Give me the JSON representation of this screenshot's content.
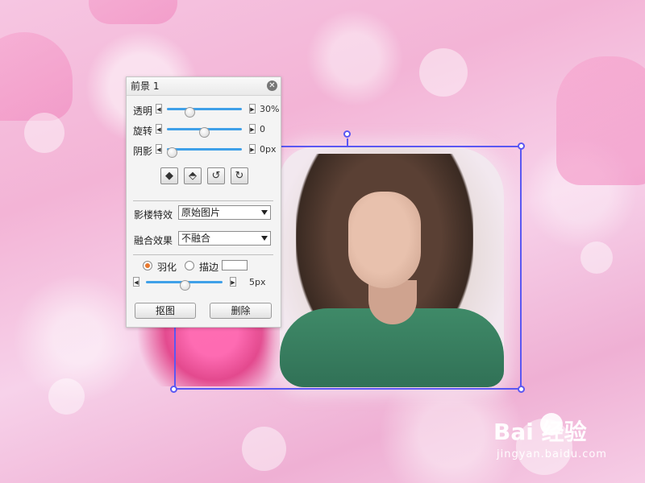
{
  "panel": {
    "title": "前景 1",
    "close_icon": "close-icon",
    "sliders": [
      {
        "label": "透明",
        "value": "30%",
        "level": 0.3
      },
      {
        "label": "旋转",
        "value": "0",
        "level": 0.5
      },
      {
        "label": "阴影",
        "value": "0px",
        "level": 0.0
      }
    ],
    "tools": [
      "flip-horizontal-icon",
      "flip-vertical-icon",
      "rotate-left-icon",
      "rotate-right-icon"
    ],
    "effect_label": "影楼特效",
    "effect_value": "原始图片",
    "blend_label": "融合效果",
    "blend_value": "不融合",
    "feather_label": "羽化",
    "stroke_label": "描边",
    "feather_selected": true,
    "feather_value": "5px",
    "feather_level": 0.5,
    "cutout_button": "抠图",
    "delete_button": "删除"
  },
  "watermark": {
    "logo": "Bai  经验",
    "sub": "jingyan.baidu.com"
  },
  "colors": {
    "accent": "#5b57f2",
    "slider": "#3fa0e8",
    "radio_selected": "#e8782e"
  }
}
